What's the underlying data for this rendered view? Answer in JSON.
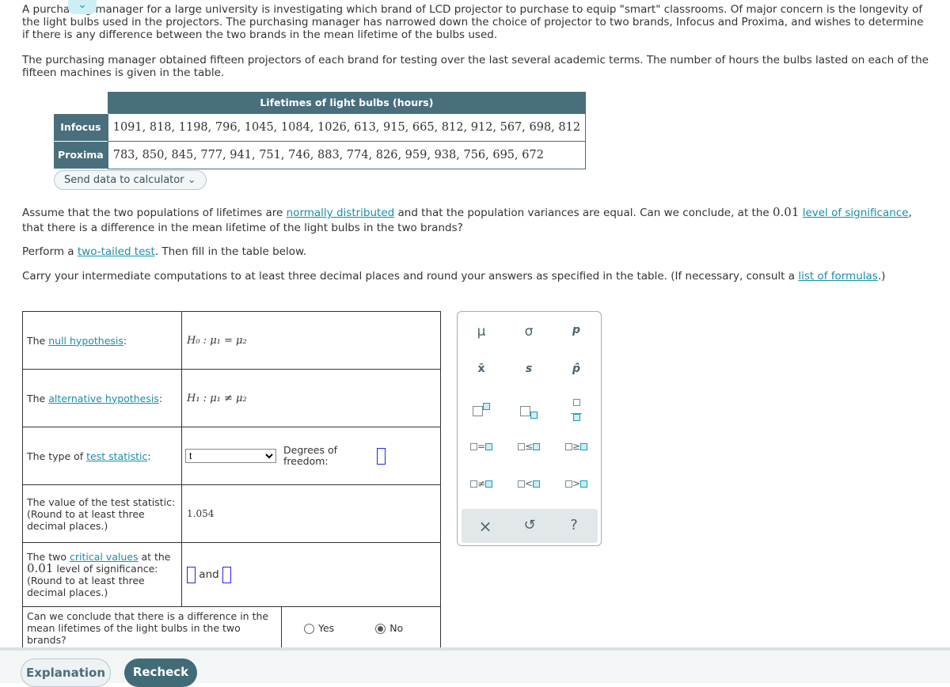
{
  "intro": {
    "p1": "A purchasing manager for a large university is investigating which brand of LCD projector to purchase to equip \"smart\" classrooms. Of major concern is the longevity of the light bulbs used in the projectors. The purchasing manager has narrowed down the choice of projector to two brands, Infocus and Proxima, and wishes to determine if there is any difference between the two brands in the mean lifetime of the bulbs used.",
    "p2": "The purchasing manager obtained fifteen projectors of each brand for testing over the last several academic terms. The number of hours the bulbs lasted on each of the fifteen machines is given in the table."
  },
  "table": {
    "header": "Lifetimes of light bulbs (hours)",
    "rows": [
      {
        "label": "Infocus",
        "values": "1091, 818, 1198, 796, 1045, 1084, 1026, 613, 915, 665, 812, 912, 567, 698, 812"
      },
      {
        "label": "Proxima",
        "values": "783, 850, 845, 777, 941, 751, 746, 883, 774, 826, 959, 938, 756, 695, 672"
      }
    ],
    "send_label": "Send data to calculator"
  },
  "q": {
    "a": "Assume that the two populations of lifetimes are ",
    "link1": "normally distributed",
    "b": " and that the population variances are equal. Can we conclude, at the ",
    "alpha": "0.01",
    "c": " ",
    "link2": "level of significance",
    "d": ", that there is a difference in the mean lifetime of the light bulbs in the two brands?",
    "p4a": "Perform a ",
    "p4link": "two-tailed test",
    "p4b": ". Then fill in the table below.",
    "p5a": "Carry your intermediate computations to at least three decimal places and round your answers as specified in the table. (If necessary, consult a ",
    "p5link": "list of formulas",
    "p5b": ".)"
  },
  "answers": {
    "null": {
      "pre": "The ",
      "link": "null hypothesis",
      "post": ":",
      "value": "H₀ : μ₁ = μ₂"
    },
    "alt": {
      "pre": "The ",
      "link": "alternative hypothesis",
      "post": ":",
      "value": "H₁ : μ₁ ≠ μ₂"
    },
    "type": {
      "pre": "The type of ",
      "link": "test statistic",
      "post": ":",
      "selected": "t",
      "df_label": "Degrees of freedom:"
    },
    "stat": {
      "label": "The value of the test statistic:",
      "note": "(Round to at least three decimal places.)",
      "value": "1.054"
    },
    "crit": {
      "pre": "The two ",
      "link": "critical values",
      "post": " at the",
      "alpha": "0.01",
      "level": " level of significance:",
      "note": "(Round to at least three decimal places.)",
      "and": "and"
    },
    "conclude": {
      "label": "Can we conclude that there is a difference in the mean lifetimes of the light bulbs in the two brands?",
      "yes": "Yes",
      "no": "No",
      "selected": "No"
    }
  },
  "palette": {
    "keys": [
      "μ",
      "σ",
      "p",
      "x̄",
      "s",
      "p̂",
      "≤",
      "≥",
      "≠",
      "<",
      ">",
      "="
    ],
    "clear": "×",
    "undo": "↺",
    "help": "?"
  },
  "buttons": {
    "explanation": "Explanation",
    "recheck": "Recheck"
  },
  "colors": {
    "header": "#4a6f7c",
    "link": "#1a8dab",
    "recheck": "#426b78"
  }
}
